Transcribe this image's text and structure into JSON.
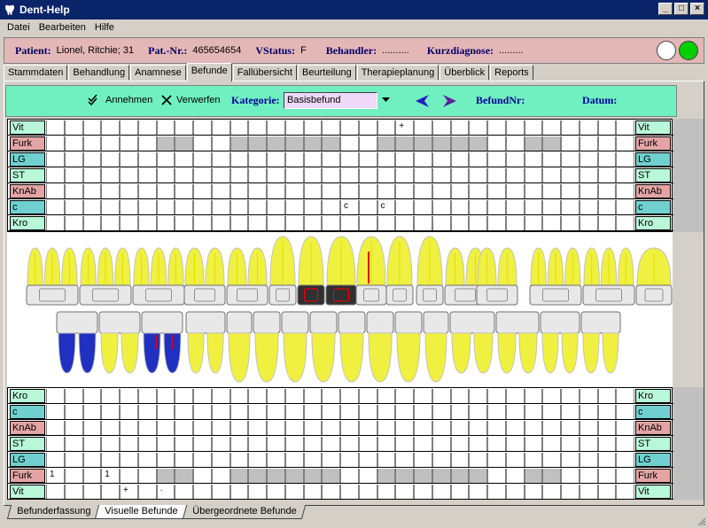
{
  "window": {
    "title": "Dent-Help",
    "minimize": "_",
    "maximize": "□",
    "close": "×"
  },
  "menu": [
    "Datei",
    "Bearbeiten",
    "Hilfe"
  ],
  "patient": {
    "patient_label": "Patient:",
    "patient_value": "Lionel, Ritchie; 31",
    "patnr_label": "Pat.-Nr.:",
    "patnr_value": "465654654",
    "vstatus_label": "VStatus:",
    "vstatus_value": "F",
    "behandler_label": "Behandler:",
    "behandler_value": "..........",
    "kurz_label": "Kurzdiagnose:",
    "kurz_value": ".........",
    "colors": {
      "circle1": "#ffffff",
      "circle2": "#00d000"
    }
  },
  "tabs": [
    "Stammdaten",
    "Behandlung",
    "Anamnese",
    "Befunde",
    "Fallübersicht",
    "Beurteilung",
    "Therapieplanung",
    "Überblick",
    "Reports"
  ],
  "active_tab": "Befunde",
  "toolbar": {
    "accept": "Annehmen",
    "reject": "Verwerfen",
    "kategorie_label": "Kategorie:",
    "kategorie_value": "Basisbefund",
    "befundnr_label": "BefundNr:",
    "datum_label": "Datum:"
  },
  "upper_rows": [
    {
      "label": "Vit",
      "color": "#b8f8d8",
      "cells": [
        "",
        "",
        "",
        "",
        "",
        "",
        "",
        "",
        "",
        "",
        "",
        "",
        "",
        "",
        "",
        "",
        "",
        "",
        "",
        "+",
        "",
        "",
        "",
        "",
        "",
        "",
        "",
        "",
        "",
        "",
        "",
        ""
      ]
    },
    {
      "label": "Furk",
      "color": "#e4a4a4",
      "cells": []
    },
    {
      "label": "LG",
      "color": "#70d0d0",
      "cells": []
    },
    {
      "label": "ST",
      "color": "#b8f8d8",
      "cells": []
    },
    {
      "label": "KnAb",
      "color": "#e4a4a4",
      "cells": []
    },
    {
      "label": "c",
      "color": "#70d0d0",
      "cells": [
        "",
        "",
        "",
        "",
        "",
        "",
        "",
        "",
        "",
        "",
        "",
        "",
        "",
        "",
        "",
        "",
        "c",
        "",
        "c",
        "",
        "",
        "",
        "",
        "",
        "",
        "",
        "",
        "",
        "",
        "",
        "",
        ""
      ]
    },
    {
      "label": "Kro",
      "color": "#b8f8d8",
      "cells": []
    }
  ],
  "lower_rows": [
    {
      "label": "Kro",
      "color": "#b8f8d8",
      "cells": []
    },
    {
      "label": "c",
      "color": "#70d0d0",
      "cells": []
    },
    {
      "label": "KnAb",
      "color": "#e4a4a4",
      "cells": []
    },
    {
      "label": "ST",
      "color": "#b8f8d8",
      "cells": []
    },
    {
      "label": "LG",
      "color": "#70d0d0",
      "cells": []
    },
    {
      "label": "Furk",
      "color": "#e4a4a4",
      "cells": [
        "1",
        "",
        "",
        "1",
        "",
        "",
        "",
        "",
        "",
        "",
        "",
        "",
        "",
        "",
        "",
        "",
        "",
        "",
        "",
        "",
        "",
        "",
        "",
        "",
        "",
        "",
        "",
        "",
        "",
        "",
        "",
        ""
      ]
    },
    {
      "label": "Vit",
      "color": "#b8f8d8",
      "cells": [
        "",
        "",
        "",
        "",
        "+",
        "",
        "·",
        "",
        "",
        "",
        "",
        "",
        "",
        "",
        "",
        "",
        "",
        "",
        "",
        "",
        "",
        "",
        "",
        "",
        "",
        "",
        "",
        "",
        "",
        "",
        "",
        ""
      ]
    }
  ],
  "bottom_tabs": [
    "Befunderfassung",
    "Visuelle Befunde",
    "Übergeordnete Befunde"
  ],
  "active_bottom_tab": "Visuelle Befunde",
  "colors": {
    "title_bg": "#0a246a",
    "patient_bg": "#e4b7b7",
    "toolbar_bg": "#70f0c0",
    "tooth_root": "#f0f040",
    "kategorie_bg": "#f0d8f8"
  },
  "icons": {
    "accept": "double-check-icon",
    "reject": "x-icon",
    "prev": "arrow-left-icon",
    "next": "arrow-right-icon",
    "dropdown": "chevron-down-icon"
  }
}
